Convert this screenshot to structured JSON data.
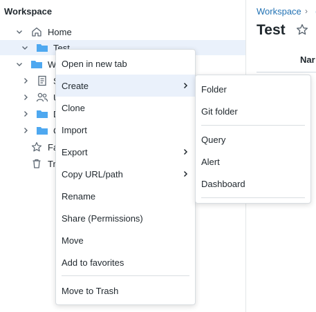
{
  "sidebar": {
    "title": "Workspace",
    "tree": [
      {
        "label": "Home",
        "icon": "home-icon"
      },
      {
        "label": "Test",
        "icon": "folder-icon"
      },
      {
        "label": "W",
        "icon": "folder-icon"
      },
      {
        "label": "S",
        "icon": "document-icon"
      },
      {
        "label": "U",
        "icon": "users-icon"
      },
      {
        "label": "D",
        "icon": "folder-icon"
      },
      {
        "label": "C",
        "icon": "folder-icon"
      },
      {
        "label": "Fa",
        "icon": "star-icon"
      },
      {
        "label": "Tr",
        "icon": "trash-icon"
      }
    ]
  },
  "main": {
    "breadcrumb": "Workspace",
    "breadcrumb_sep": "›",
    "breadcrumb_more": "(",
    "title": "Test",
    "column_header": "Nar"
  },
  "context_menu": {
    "items": [
      {
        "label": "Open in new tab"
      },
      {
        "label": "Create"
      },
      {
        "label": "Clone"
      },
      {
        "label": "Import"
      },
      {
        "label": "Export"
      },
      {
        "label": "Copy URL/path"
      },
      {
        "label": "Rename"
      },
      {
        "label": "Share (Permissions)"
      },
      {
        "label": "Move"
      },
      {
        "label": "Add to favorites"
      },
      {
        "label": "Move to Trash"
      }
    ]
  },
  "submenu": {
    "items": [
      {
        "label": "Folder"
      },
      {
        "label": "Git folder"
      },
      {
        "label": "Query"
      },
      {
        "label": "Alert"
      },
      {
        "label": "Dashboard"
      }
    ]
  },
  "colors": {
    "accent": "#2272b4",
    "folder": "#4ea8f0",
    "hover": "#eaf1fb",
    "text": "#1f272d"
  }
}
